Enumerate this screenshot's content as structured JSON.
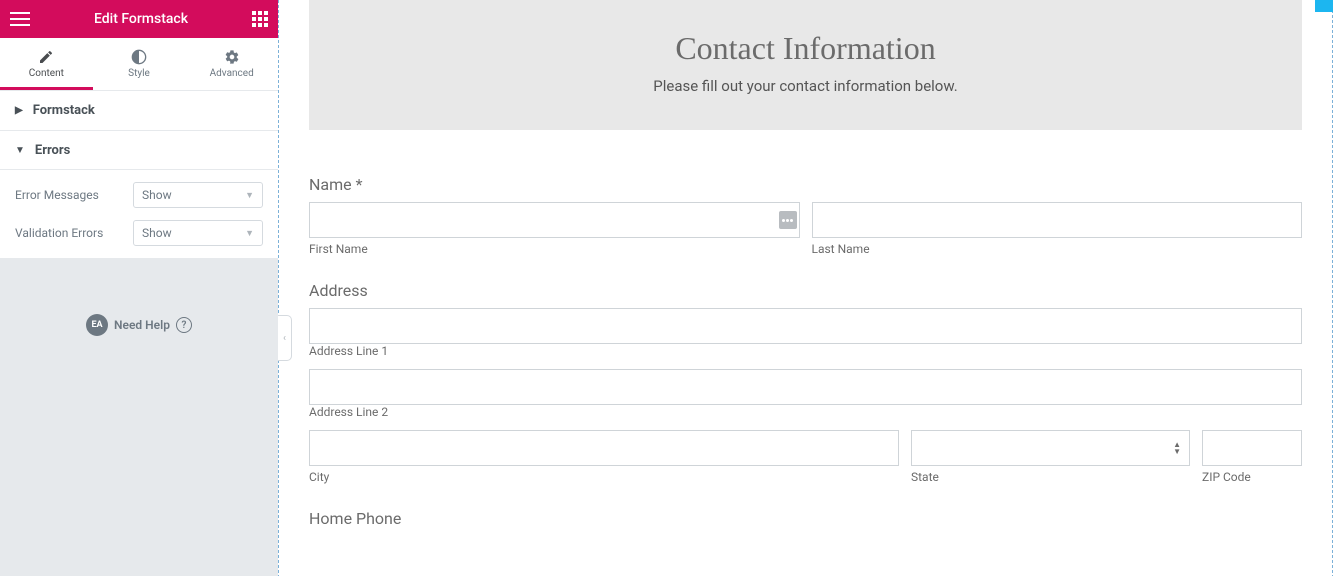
{
  "sidebar": {
    "title": "Edit Formstack",
    "tabs": {
      "content": "Content",
      "style": "Style",
      "advanced": "Advanced"
    },
    "sections": {
      "formstack": "Formstack",
      "errors": "Errors"
    },
    "controls": {
      "error_messages_label": "Error Messages",
      "error_messages_value": "Show",
      "validation_errors_label": "Validation Errors",
      "validation_errors_value": "Show"
    },
    "need_help_badge": "EA",
    "need_help_label": "Need Help",
    "need_help_q": "?"
  },
  "form": {
    "header_title": "Contact Information",
    "header_sub": "Please fill out your contact information below.",
    "name_label": "Name *",
    "first_name_sub": "First Name",
    "last_name_sub": "Last Name",
    "address_label": "Address",
    "address_line1_sub": "Address Line 1",
    "address_line2_sub": "Address Line 2",
    "city_sub": "City",
    "state_sub": "State",
    "zip_sub": "ZIP Code",
    "home_phone_label": "Home Phone"
  }
}
